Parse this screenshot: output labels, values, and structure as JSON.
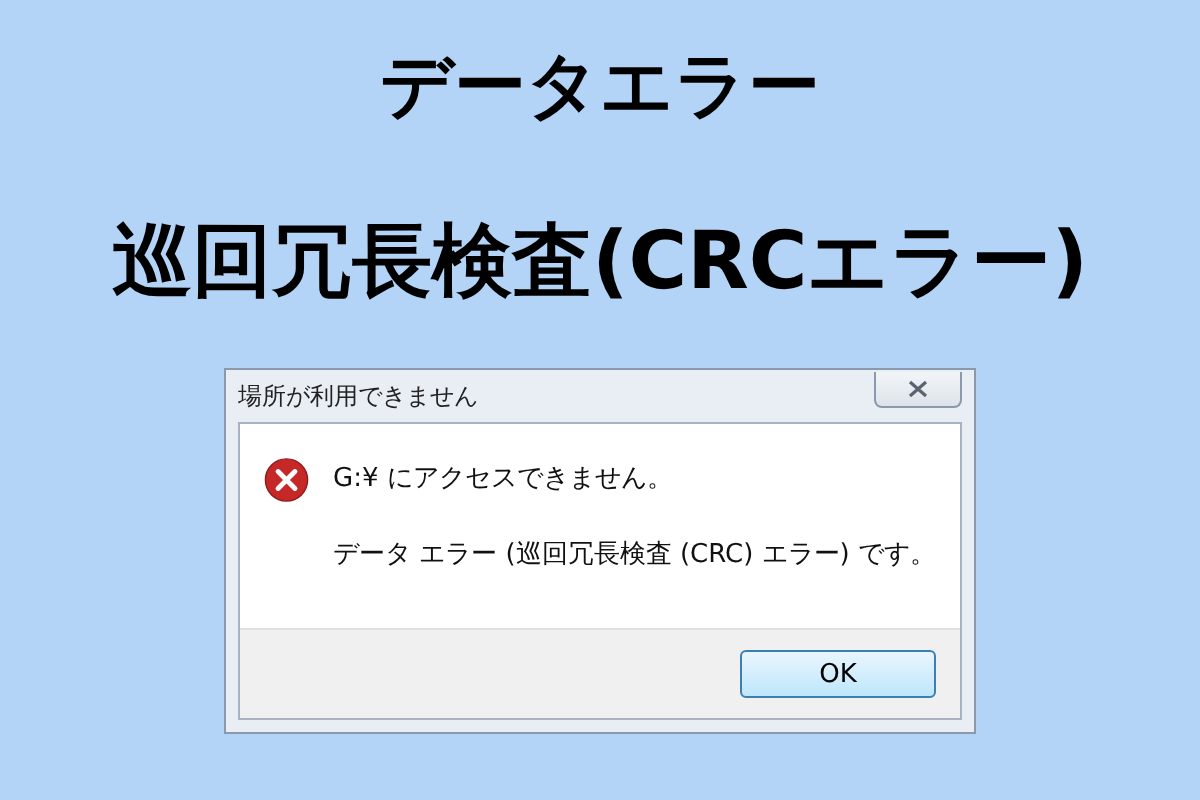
{
  "headline": {
    "lines": [
      "データエラー",
      "巡回冗長検査(CRCエラー)"
    ]
  },
  "dialog": {
    "title": "場所が利用できません",
    "message": "G:¥ にアクセスできません。",
    "detail": "データ エラー (巡回冗長検査 (CRC) エラー) です。",
    "buttons": [
      "OK"
    ]
  }
}
